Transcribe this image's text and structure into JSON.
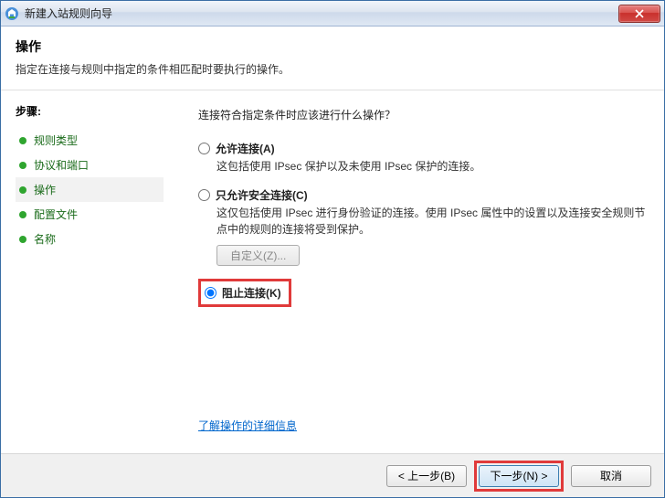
{
  "window": {
    "title": "新建入站规则向导"
  },
  "header": {
    "title": "操作",
    "subtitle": "指定在连接与规则中指定的条件相匹配时要执行的操作。"
  },
  "sidebar": {
    "steps_label": "步骤:",
    "items": [
      {
        "label": "规则类型"
      },
      {
        "label": "协议和端口"
      },
      {
        "label": "操作"
      },
      {
        "label": "配置文件"
      },
      {
        "label": "名称"
      }
    ]
  },
  "main": {
    "question": "连接符合指定条件时应该进行什么操作？",
    "options": {
      "allow": {
        "label": "允许连接(A)",
        "desc": "这包括使用 IPsec 保护以及未使用 IPsec 保护的连接。"
      },
      "secure": {
        "label": "只允许安全连接(C)",
        "desc": "这仅包括使用 IPsec 进行身份验证的连接。使用 IPsec 属性中的设置以及连接安全规则节点中的规则的连接将受到保护。",
        "custom_button": "自定义(Z)..."
      },
      "block": {
        "label": "阻止连接(K)"
      }
    },
    "more_link": "了解操作的详细信息"
  },
  "footer": {
    "back": "< 上一步(B)",
    "next": "下一步(N) >",
    "cancel": "取消"
  }
}
